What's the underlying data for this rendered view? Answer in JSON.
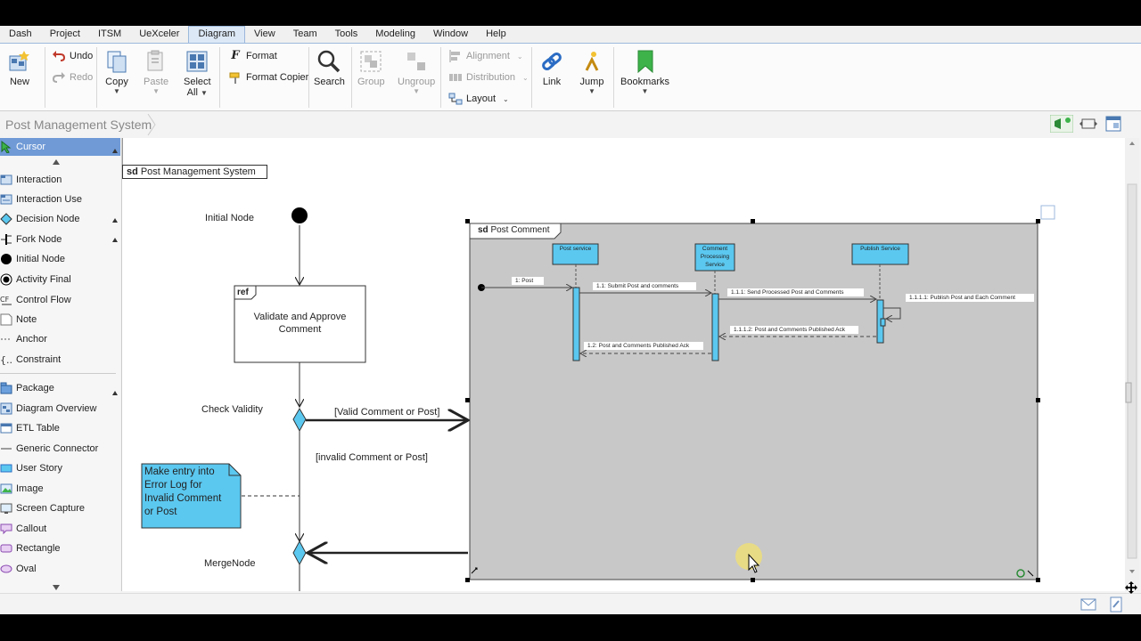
{
  "menu": [
    "Dash",
    "Project",
    "ITSM",
    "UeXceler",
    "Diagram",
    "View",
    "Team",
    "Tools",
    "Modeling",
    "Window",
    "Help"
  ],
  "menu_active_index": 4,
  "ribbon": {
    "new": "New",
    "undo": "Undo",
    "redo": "Redo",
    "copy": "Copy",
    "paste": "Paste",
    "select_all_1": "Select",
    "select_all_2": "All",
    "format": "Format",
    "format_copier": "Format Copier",
    "search": "Search",
    "group": "Group",
    "ungroup": "Ungroup",
    "alignment": "Alignment",
    "distribution": "Distribution",
    "layout": "Layout",
    "link": "Link",
    "jump": "Jump",
    "bookmarks": "Bookmarks"
  },
  "breadcrumb": "Post Management System",
  "palette": [
    {
      "label": "Cursor",
      "icon": "cursor-icon"
    },
    {
      "label": "Interaction",
      "icon": "interaction-icon"
    },
    {
      "label": "Interaction Use",
      "icon": "interaction-use-icon"
    },
    {
      "label": "Decision Node",
      "icon": "decision-node-icon"
    },
    {
      "label": "Fork Node",
      "icon": "fork-node-icon"
    },
    {
      "label": "Initial Node",
      "icon": "initial-node-icon"
    },
    {
      "label": "Activity Final",
      "icon": "activity-final-icon"
    },
    {
      "label": "Control Flow",
      "icon": "control-flow-icon"
    },
    {
      "label": "Note",
      "icon": "note-icon"
    },
    {
      "label": "Anchor",
      "icon": "anchor-icon"
    },
    {
      "label": "Constraint",
      "icon": "constraint-icon"
    },
    {
      "label": "Package",
      "icon": "package-icon"
    },
    {
      "label": "Diagram Overview",
      "icon": "diagram-overview-icon"
    },
    {
      "label": "ETL Table",
      "icon": "etl-table-icon"
    },
    {
      "label": "Generic Connector",
      "icon": "generic-connector-icon"
    },
    {
      "label": "User Story",
      "icon": "user-story-icon"
    },
    {
      "label": "Image",
      "icon": "image-icon"
    },
    {
      "label": "Screen Capture",
      "icon": "screen-capture-icon"
    },
    {
      "label": "Callout",
      "icon": "callout-icon"
    },
    {
      "label": "Rectangle",
      "icon": "rectangle-icon"
    },
    {
      "label": "Oval",
      "icon": "oval-icon"
    }
  ],
  "diagram": {
    "frame_kind": "sd",
    "frame_title": "Post Management System",
    "initial_node": "Initial Node",
    "ref_kind": "ref",
    "ref_text_1": "Validate and Approve",
    "ref_text_2": "Comment",
    "check_validity": "Check Validity",
    "guard_valid": "[Valid Comment or Post]",
    "guard_invalid": "[invalid Comment or Post]",
    "note_lines": [
      "Make entry into",
      "Error Log for",
      "Invalid Comment",
      "or Post"
    ],
    "merge_node": "MergeNode"
  },
  "sequence": {
    "frame_kind": "sd",
    "frame_title": "Post Comment",
    "lifelines": [
      {
        "lines": [
          "Post service"
        ]
      },
      {
        "lines": [
          "Comment",
          "Processing",
          "Service"
        ]
      },
      {
        "lines": [
          "Publish Service"
        ]
      }
    ],
    "messages": {
      "m1": "1: Post",
      "m2": "1.1: Submit Post and comments",
      "m3": "1.1.1: Send Processed Post and Comments",
      "m4": "1.1.1.1: Publish Post and Each Comment",
      "m5": "1.1.1.2: Post and Comments Published Ack",
      "m6": "1.2: Post and Comments Published Ack"
    }
  },
  "colors": {
    "lifeline_fill": "#5bc8f0",
    "note_fill": "#5bc8f0",
    "seq_background": "#c8c8c8",
    "accent": "#6f9ad6"
  }
}
